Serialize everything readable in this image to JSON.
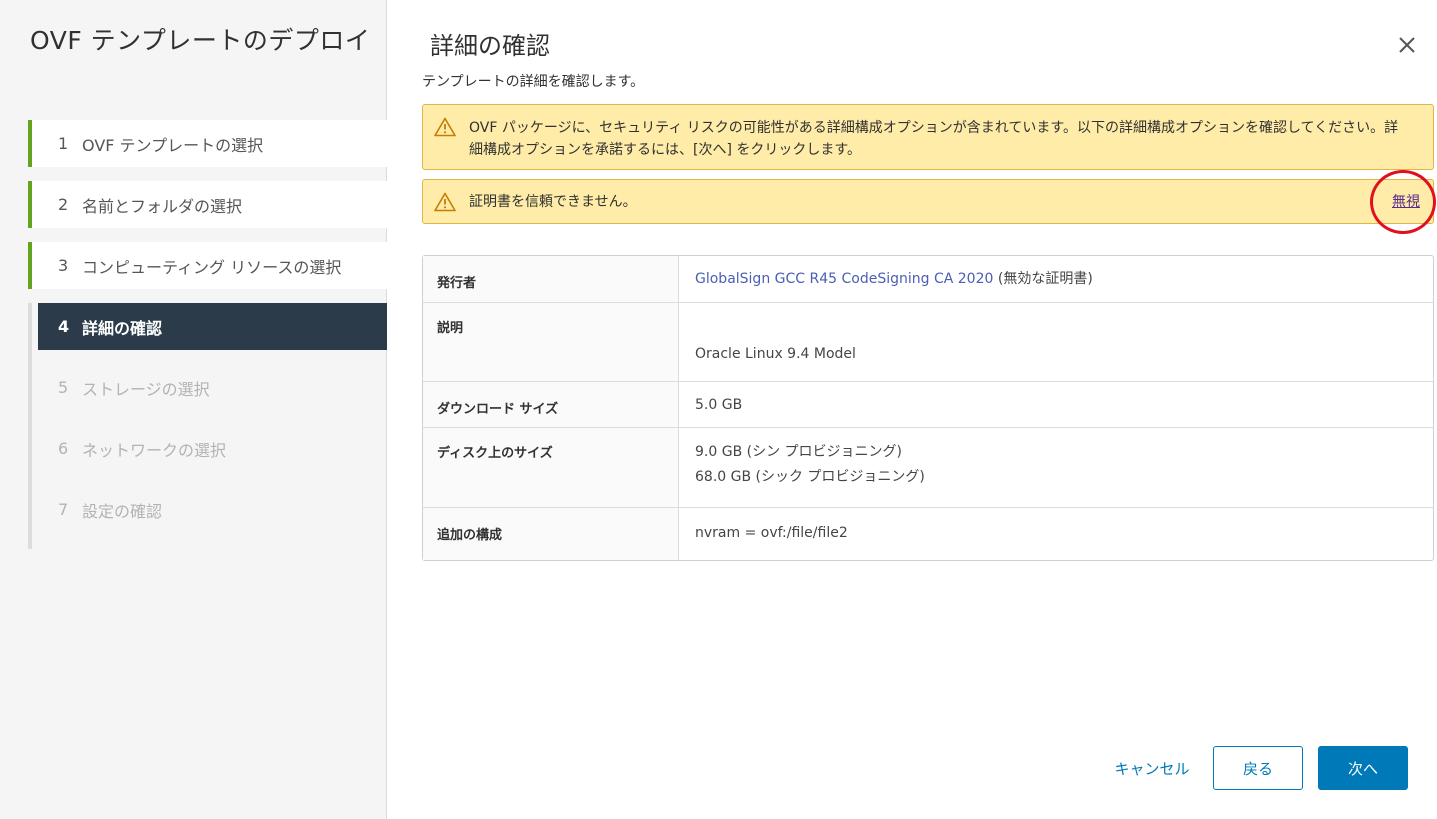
{
  "wizard": {
    "title": "OVF テンプレートのデプロイ",
    "steps": [
      {
        "num": "1",
        "label": "OVF テンプレートの選択",
        "state": "done"
      },
      {
        "num": "2",
        "label": "名前とフォルダの選択",
        "state": "done"
      },
      {
        "num": "3",
        "label": "コンピューティング リソースの選択",
        "state": "done"
      },
      {
        "num": "4",
        "label": "詳細の確認",
        "state": "active"
      },
      {
        "num": "5",
        "label": "ストレージの選択",
        "state": "todo"
      },
      {
        "num": "6",
        "label": "ネットワークの選択",
        "state": "todo"
      },
      {
        "num": "7",
        "label": "設定の確認",
        "state": "todo"
      }
    ]
  },
  "main": {
    "title": "詳細の確認",
    "subtitle": "テンプレートの詳細を確認します。",
    "close_icon": "close-icon"
  },
  "alerts": {
    "security": "OVF パッケージに、セキュリティ リスクの可能性がある詳細構成オプションが含まれています。以下の詳細構成オプションを確認してください。詳細構成オプションを承諾するには、[次へ] をクリックします。",
    "certificate": "証明書を信頼できません。",
    "dismiss_label": "無視",
    "icon": "warning-icon"
  },
  "details": {
    "publisher_label": "発行者",
    "publisher_link": "GlobalSign GCC R45 CodeSigning CA 2020",
    "publisher_note": " (無効な証明書)",
    "description_label": "説明",
    "description_value": "Oracle Linux 9.4 Model",
    "download_size_label": "ダウンロード サイズ",
    "download_size_value": "5.0 GB",
    "disk_size_label": "ディスク上のサイズ",
    "disk_size_thin": "9.0 GB (シン プロビジョニング)",
    "disk_size_thick": "68.0 GB (シック プロビジョニング)",
    "extra_config_label": "追加の構成",
    "extra_config_value": "nvram = ovf:/file/file2"
  },
  "footer": {
    "cancel_label": "キャンセル",
    "back_label": "戻る",
    "next_label": "次へ"
  },
  "colors": {
    "accent": "#0079b8",
    "done_bar": "#62a420",
    "active_step_bg": "#2b3b4a",
    "alert_bg": "#feeca8",
    "highlight": "#e0101e"
  }
}
